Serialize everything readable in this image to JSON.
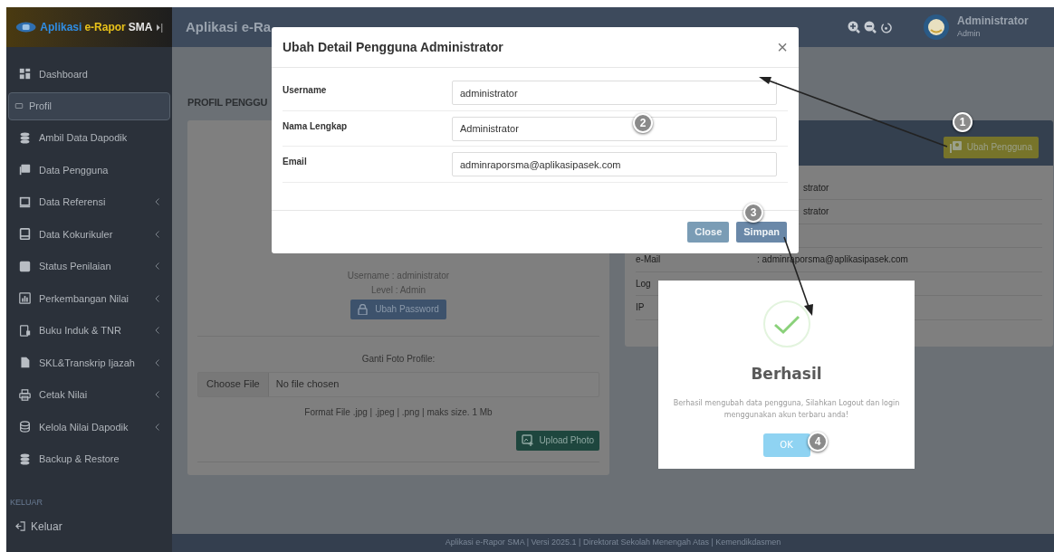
{
  "logo": {
    "words": [
      {
        "text": "Aplikasi",
        "color": "#2f8de4"
      },
      {
        "text": "e-Rapor",
        "color": "#e8c21a"
      },
      {
        "text": "SMA",
        "color": "#e6e6e6"
      }
    ],
    "toggle": "⏵|"
  },
  "header": {
    "title": "Aplikasi e-Ra",
    "user_name": "Administrator",
    "user_role": "Admin"
  },
  "sidebar": {
    "items": [
      {
        "label": "Dashboard",
        "selected": false,
        "expandable": false
      },
      {
        "label": "Profil",
        "selected": true,
        "expandable": false
      },
      {
        "label": "Ambil Data Dapodik",
        "selected": false,
        "expandable": false
      },
      {
        "label": "Data Pengguna",
        "selected": false,
        "expandable": false
      },
      {
        "label": "Data Referensi",
        "selected": false,
        "expandable": true
      },
      {
        "label": "Data Kokurikuler",
        "selected": false,
        "expandable": true
      },
      {
        "label": "Status Penilaian",
        "selected": false,
        "expandable": true
      },
      {
        "label": "Perkembangan Nilai",
        "selected": false,
        "expandable": true
      },
      {
        "label": "Buku Induk & TNR",
        "selected": false,
        "expandable": true
      },
      {
        "label": "SKL&Transkrip Ijazah",
        "selected": false,
        "expandable": true
      },
      {
        "label": "Cetak Nilai",
        "selected": false,
        "expandable": true
      },
      {
        "label": "Kelola Nilai Dapodik",
        "selected": false,
        "expandable": true
      },
      {
        "label": "Backup & Restore",
        "selected": false,
        "expandable": false
      }
    ],
    "section": "KELUAR",
    "logout": "Keluar"
  },
  "page_title": "PROFIL PENGGU",
  "profile_card": {
    "username_line": "Username : administrator",
    "level_line": "Level : Admin",
    "password_button": "Ubah Password",
    "photo_label": "Ganti Foto Profile:",
    "file_button": "Choose File",
    "file_status": "No file chosen",
    "format_hint": "Format File .jpg | .jpeg | .png | maks size. 1 Mb",
    "upload_button": "Upload Photo"
  },
  "detail_card": {
    "edit_button": "Ubah Pengguna",
    "rows": [
      {
        "value": "strator"
      },
      {
        "value": "strator"
      },
      {
        "value": ""
      },
      {
        "label": "e-Mail",
        "value": ": adminraporsma@aplikasipasek.com"
      },
      {
        "label": "Log"
      },
      {
        "label": "IP"
      }
    ]
  },
  "modal": {
    "title": "Ubah Detail Pengguna Administrator",
    "close": "×",
    "fields": [
      {
        "label": "Username",
        "value": "administrator"
      },
      {
        "label": "Nama Lengkap",
        "value": "Administrator"
      },
      {
        "label": "Email",
        "value": "adminraporsma@aplikasipasek.com"
      }
    ],
    "buttons": [
      {
        "label": "Close",
        "kind": "secondary"
      },
      {
        "label": "Simpan",
        "kind": "primary"
      }
    ]
  },
  "alert": {
    "title": "Berhasil",
    "message": "Berhasil mengubah data pengguna, Silahkan Logout dan login menggunakan akun terbaru anda!",
    "button": "OK"
  },
  "steps": [
    "1",
    "2",
    "3",
    "4"
  ],
  "footer": "Aplikasi e-Rapor SMA | Versi 2025.1 | Direktorat Sekolah Menengah Atas | Kemendikdasmen"
}
